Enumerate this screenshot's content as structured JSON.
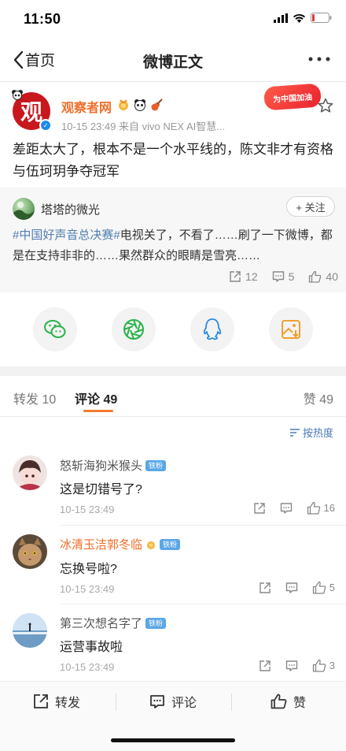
{
  "status_bar": {
    "time": "11:50"
  },
  "nav": {
    "back_label": "首页",
    "title": "微博正文"
  },
  "post": {
    "avatar_char": "观",
    "author": "观察者网",
    "meta": "10-15 23:49  来自 vivo NEX AI智慧...",
    "promo_badge": "为中国加油",
    "text": "差距太大了，根本不是一个水平线的，陈文非才有资格与伍珂玥争夺冠军"
  },
  "retweet": {
    "author": "塔塔的微光",
    "follow_label": "+ 关注",
    "hashtag": "#中国好声音总决赛#",
    "text": "电视关了，不看了……刷了一下微博，都是在支持非非的……果然群众的眼睛是雪亮……",
    "reposts": "12",
    "comments": "5",
    "likes": "40"
  },
  "share_icons": [
    "wechat-icon",
    "moments-icon",
    "qq-icon",
    "save-image-icon"
  ],
  "tabs": {
    "repost_label": "转发",
    "repost_count": "10",
    "comment_label": "评论",
    "comment_count": "49",
    "like_label": "赞",
    "like_count": "49"
  },
  "sort_label": "按热度",
  "comments": [
    {
      "name": "怒斩海狗米猴头",
      "badge": "铁粉",
      "text": "这是切错号了?",
      "time": "10-15 23:49",
      "likes": "16"
    },
    {
      "name": "冰清玉洁郭冬临",
      "badge": "铁粉",
      "text": "忘换号啦?",
      "time": "10-15 23:49",
      "likes": "5"
    },
    {
      "name": "第三次想名字了",
      "badge": "铁粉",
      "text": "运营事故啦",
      "time": "10-15 23:49",
      "likes": "3"
    }
  ],
  "bottom_bar": {
    "repost": "转发",
    "comment": "评论",
    "like": "赞"
  },
  "colors": {
    "accent": "#f07a2c",
    "link": "#507daf",
    "vip_name": "#f06e2a",
    "verified": "#1e8be9"
  }
}
